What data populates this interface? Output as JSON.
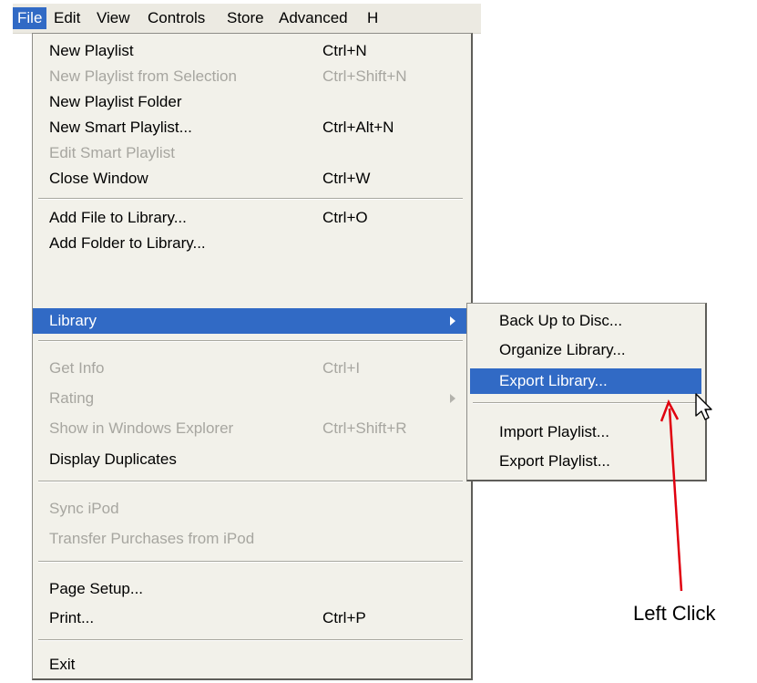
{
  "menubar": {
    "items": [
      "File",
      "Edit",
      "View",
      "Controls",
      "Store",
      "Advanced",
      "H"
    ]
  },
  "file_menu": {
    "items": [
      {
        "label": "New Playlist",
        "shortcut": "Ctrl+N",
        "enabled": true
      },
      {
        "label": "New Playlist from Selection",
        "shortcut": "Ctrl+Shift+N",
        "enabled": false
      },
      {
        "label": "New Playlist Folder",
        "shortcut": "",
        "enabled": true
      },
      {
        "label": "New Smart Playlist...",
        "shortcut": "Ctrl+Alt+N",
        "enabled": true
      },
      {
        "label": "Edit Smart Playlist",
        "shortcut": "",
        "enabled": false
      },
      {
        "label": "Close Window",
        "shortcut": "Ctrl+W",
        "enabled": true
      },
      {
        "label": "Add File to Library...",
        "shortcut": "Ctrl+O",
        "enabled": true
      },
      {
        "label": "Add Folder to Library...",
        "shortcut": "",
        "enabled": true
      },
      {
        "label": "Library",
        "shortcut": "",
        "enabled": true,
        "highlighted": true,
        "submenu": true
      },
      {
        "label": "Get Info",
        "shortcut": "Ctrl+I",
        "enabled": false
      },
      {
        "label": "Rating",
        "shortcut": "",
        "enabled": false,
        "submenu": true
      },
      {
        "label": "Show in Windows Explorer",
        "shortcut": "Ctrl+Shift+R",
        "enabled": false
      },
      {
        "label": "Display Duplicates",
        "shortcut": "",
        "enabled": true
      },
      {
        "label": "Sync iPod",
        "shortcut": "",
        "enabled": false
      },
      {
        "label": "Transfer Purchases from iPod",
        "shortcut": "",
        "enabled": false
      },
      {
        "label": "Page Setup...",
        "shortcut": "",
        "enabled": true
      },
      {
        "label": "Print...",
        "shortcut": "Ctrl+P",
        "enabled": true
      },
      {
        "label": "Exit",
        "shortcut": "",
        "enabled": true
      }
    ]
  },
  "library_submenu": {
    "items": [
      {
        "label": "Back Up to Disc...",
        "highlighted": false
      },
      {
        "label": "Organize Library...",
        "highlighted": false
      },
      {
        "label": "Export Library...",
        "highlighted": true
      },
      {
        "label": "Import Playlist...",
        "highlighted": false
      },
      {
        "label": "Export Playlist...",
        "highlighted": false
      }
    ]
  },
  "annotation": {
    "text": "Left Click",
    "color": "#e0000f"
  },
  "colors": {
    "highlight": "#316ac5",
    "menu_bg": "#f2f1ea",
    "disabled_text": "#a7a6a0"
  }
}
